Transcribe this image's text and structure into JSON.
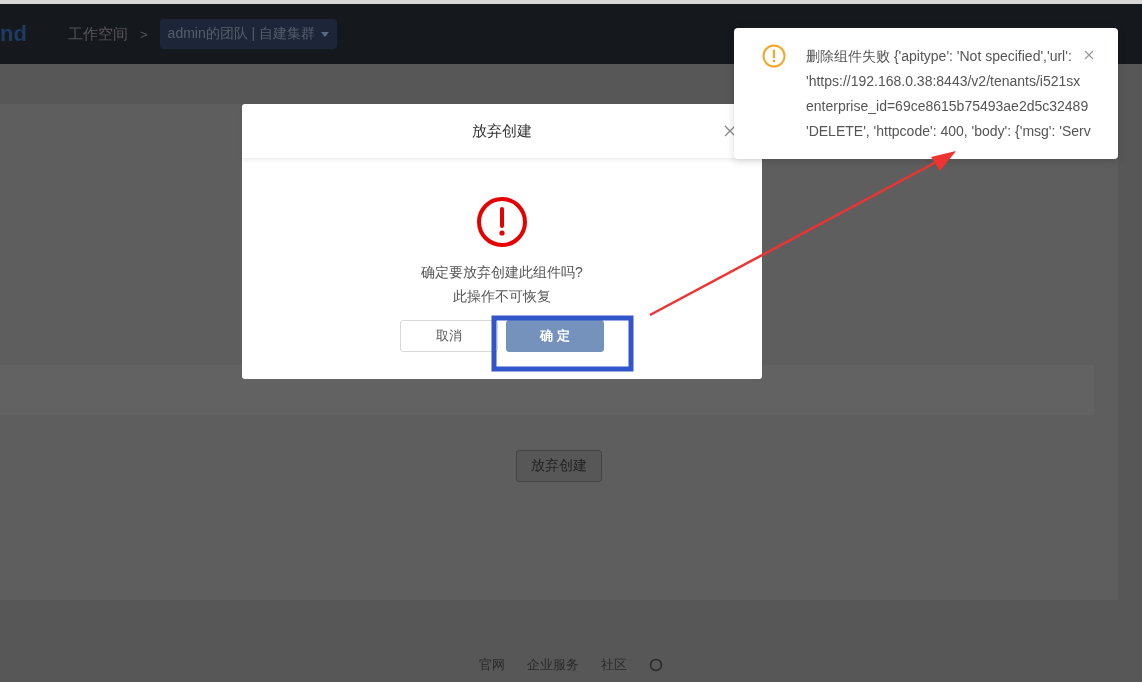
{
  "header": {
    "logo": "nd",
    "breadcrumb": "工作空间",
    "separator": ">",
    "team_selector": "admin的团队 | 自建集群"
  },
  "page": {
    "abandon_button": "放弃创建"
  },
  "footer": {
    "links": [
      "官网",
      "企业服务",
      "社区"
    ]
  },
  "dialog": {
    "title": "放弃创建",
    "message": "确定要放弃创建此组件吗?",
    "note": "此操作不可恢复",
    "buttons": [
      {
        "label": "取消",
        "kind": "default"
      },
      {
        "label": "确 定",
        "kind": "primary"
      }
    ]
  },
  "notification": {
    "kind": "warning",
    "lines": [
      "删除组件失败 {'apitype': 'Not specified','url':",
      "'https://192.168.0.38:8443/v2/tenants/i521sx",
      "enterprise_id=69ce8615b75493ae2d5c32489",
      "'DELETE', 'httpcode': 400, 'body': {'msg': 'Serv"
    ]
  }
}
